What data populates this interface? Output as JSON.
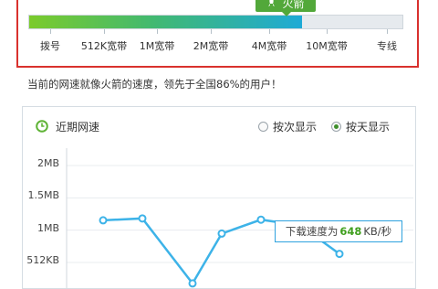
{
  "speed_meter": {
    "badge_label": "火箭",
    "badge_icon": "rocket-icon",
    "level_fraction": 0.73,
    "scale_labels": [
      "拨号",
      "512K宽带",
      "1M宽带",
      "2M宽带",
      "4M宽带",
      "10M宽带",
      "专线"
    ],
    "colors": {
      "fill_start": "#7bcb2c",
      "fill_end": "#1eaad6",
      "badge": "#52a83a",
      "frame": "#d9312e"
    }
  },
  "summary_text": "当前的网速就像火箭的速度，领先于全国86%的用户！",
  "recent_speed": {
    "icon": "clock-icon",
    "title": "近期网速",
    "options": [
      {
        "label": "按次显示",
        "checked": false
      },
      {
        "label": "按天显示",
        "checked": true
      }
    ],
    "tooltip": {
      "prefix": "下载速度为",
      "value": "648",
      "unit": "KB/秒"
    }
  },
  "chart_data": {
    "type": "line",
    "y_tick_labels": [
      "2MB",
      "1.5MB",
      "1MB",
      "512KB"
    ],
    "y_tick_values_kb": [
      2048,
      1536,
      1024,
      512
    ],
    "series": [
      {
        "values_kb": [
          1180,
          1210,
          180,
          970,
          1190,
          1100,
          648
        ],
        "color": "#3db3e8"
      }
    ],
    "grid": true
  }
}
